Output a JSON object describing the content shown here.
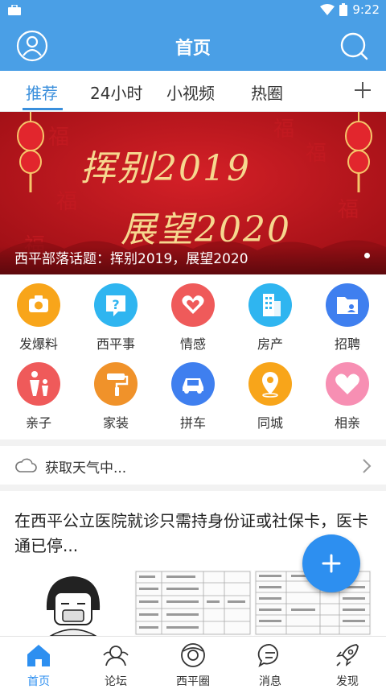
{
  "status_bar": {
    "time": "9:22"
  },
  "app_bar": {
    "title": "首页"
  },
  "tabs": [
    {
      "label": "推荐",
      "active": true
    },
    {
      "label": "24小时",
      "active": false
    },
    {
      "label": "小视频",
      "active": false
    },
    {
      "label": "热圈",
      "active": false
    }
  ],
  "banner": {
    "line1": "挥别2019",
    "line2": "展望2020",
    "caption": "西平部落话题：挥别2019，展望2020"
  },
  "categories": [
    {
      "label": "发爆料",
      "icon": "camera-icon",
      "color": "#f8a51a"
    },
    {
      "label": "西平事",
      "icon": "question-icon",
      "color": "#2fb5f0"
    },
    {
      "label": "情感",
      "icon": "hearts-icon",
      "color": "#ef5a5a"
    },
    {
      "label": "房产",
      "icon": "building-icon",
      "color": "#2fb5f0"
    },
    {
      "label": "招聘",
      "icon": "folder-icon",
      "color": "#3f7fef"
    },
    {
      "label": "亲子",
      "icon": "parent-child-icon",
      "color": "#ef5a5a"
    },
    {
      "label": "家装",
      "icon": "paint-roller-icon",
      "color": "#f0922a"
    },
    {
      "label": "拼车",
      "icon": "car-icon",
      "color": "#3f7fef"
    },
    {
      "label": "同城",
      "icon": "location-pin-icon",
      "color": "#f8a51a"
    },
    {
      "label": "相亲",
      "icon": "heart-icon",
      "color": "#f78fb3"
    }
  ],
  "weather": {
    "text": "获取天气中..."
  },
  "article": {
    "headline": "在西平公立医院就诊只需持身份证或社保卡，医卡通已停..."
  },
  "bottom_nav": [
    {
      "label": "首页",
      "icon": "home-icon",
      "active": true
    },
    {
      "label": "论坛",
      "icon": "forum-icon",
      "active": false
    },
    {
      "label": "西平圈",
      "icon": "circle-icon",
      "active": false
    },
    {
      "label": "消息",
      "icon": "message-icon",
      "active": false
    },
    {
      "label": "发现",
      "icon": "rocket-icon",
      "active": false
    }
  ],
  "colors": {
    "primary": "#4a9fe6",
    "accent": "#2d8ff0",
    "banner_red": "#b8141c"
  }
}
